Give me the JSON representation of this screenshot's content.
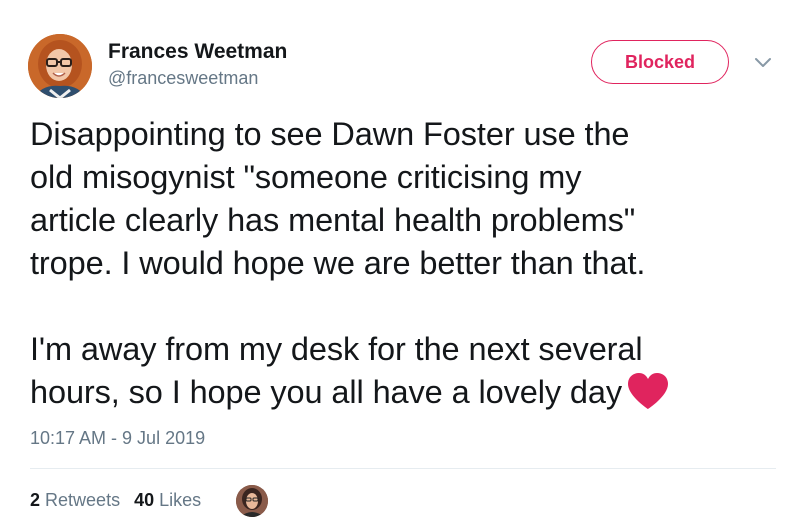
{
  "author": {
    "display_name": "Frances Weetman",
    "handle": "@francesweetman",
    "avatar_icon": "profile-photo"
  },
  "actions": {
    "blocked_label": "Blocked",
    "menu_icon": "chevron-down-icon"
  },
  "tweet": {
    "lines_paragraph_1": [
      "Disappointing to see Dawn Foster use the",
      "old misogynist \"someone criticising my",
      "article clearly has mental health problems\"",
      "trope.  I would hope we are better than that."
    ],
    "lines_paragraph_2": [
      "I'm away from my desk for the next several",
      "hours, so I hope you all have a lovely day"
    ],
    "emoji": "red-heart-icon"
  },
  "timestamp": "10:17 AM - 9 Jul 2019",
  "stats": {
    "retweets_count": "2",
    "retweets_label": "Retweets",
    "likes_count": "40",
    "likes_label": "Likes"
  },
  "colors": {
    "blocked": "#e0245e",
    "secondary_text": "#657786",
    "heart": "#e0245e"
  }
}
